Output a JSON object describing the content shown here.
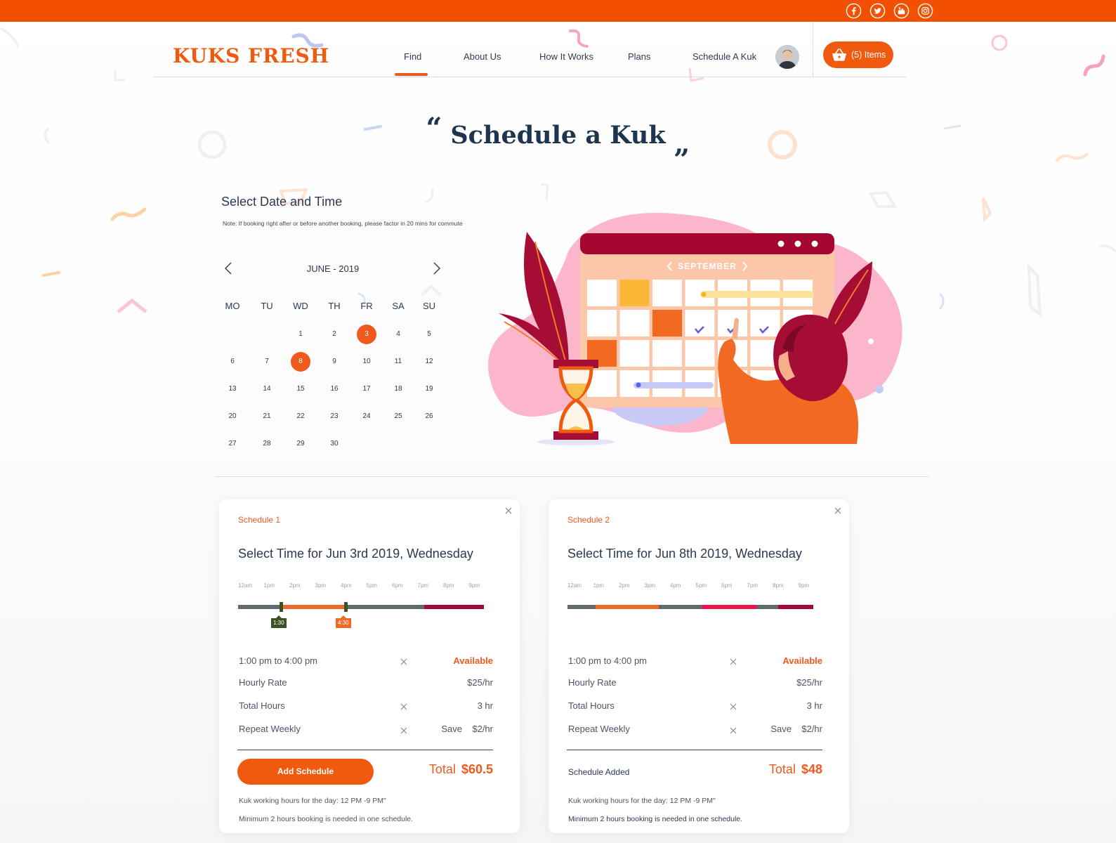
{
  "brand": {
    "name": "KUKS FRESH",
    "accent": "#f05a0e",
    "topbar_color": "#f25000"
  },
  "social": [
    "facebook-icon",
    "twitter-icon",
    "youtube-icon",
    "instagram-icon"
  ],
  "nav": {
    "items": [
      "Find",
      "About Us",
      "How It Works",
      "Plans",
      "Schedule A Kuk"
    ],
    "active": "Find",
    "cart_label": "(5) Items"
  },
  "page": {
    "title": "Schedule a Kuk",
    "open_quote": "“",
    "close_quote": "„"
  },
  "calendar": {
    "section_title": "Select Date and Time",
    "note": "Note: If booking right after or before another booking, please factor in 20 mins for commute",
    "month": "JUNE - 2019",
    "weekdays": [
      "MO",
      "TU",
      "WD",
      "TH",
      "FR",
      "SA",
      "SU"
    ],
    "first_day_column": 2,
    "days_in_month": 30,
    "selected": [
      3,
      8
    ]
  },
  "illustration": {
    "calendar_month": "SEPTEMBER"
  },
  "schedules": [
    {
      "label": "Schedule 1",
      "title": "Select Time for Jun 3rd 2019, Wednesday",
      "hours": [
        "12am",
        "1pm",
        "2pm",
        "3pm",
        "4pm",
        "5pm",
        "6pm",
        "7pm",
        "8pm",
        "9pm"
      ],
      "handle_start": "1:30",
      "handle_end": "4:30",
      "slot": "1:00 pm to 4:00 pm",
      "status": "Available",
      "hourly_rate_label": "Hourly Rate",
      "hourly_rate": "$25/hr",
      "total_hours_label": "Total Hours",
      "total_hours": "3 hr",
      "repeat_label": "Repeat Weekly",
      "save_label": "Save",
      "save_value": "$2/hr",
      "action": "Add Schedule",
      "total_label": "Total",
      "total": "$60.5",
      "working_hours": "Kuk working hours for the day: 12 PM -9 PM\"",
      "minimum": "Minimum 2 hours booking is needed in one schedule."
    },
    {
      "label": "Schedule 2",
      "title": "Select Time for Jun 8th 2019, Wednesday",
      "hours": [
        "12am",
        "1pm",
        "2pm",
        "3pm",
        "4pm",
        "5pm",
        "6pm",
        "7pm",
        "8pm",
        "9pm"
      ],
      "slot": "1:00 pm to 4:00 pm",
      "status": "Available",
      "hourly_rate_label": "Hourly Rate",
      "hourly_rate": "$25/hr",
      "total_hours_label": "Total Hours",
      "total_hours": "3 hr",
      "repeat_label": "Repeat Weekly",
      "save_label": "Save",
      "save_value": "$2/hr",
      "action": "Schedule Added",
      "total_label": "Total",
      "total": "$48",
      "working_hours": "Kuk working hours for the day: 12 PM -9 PM\"",
      "minimum": "Minimum 2 hours booking is needed in one schedule."
    }
  ]
}
